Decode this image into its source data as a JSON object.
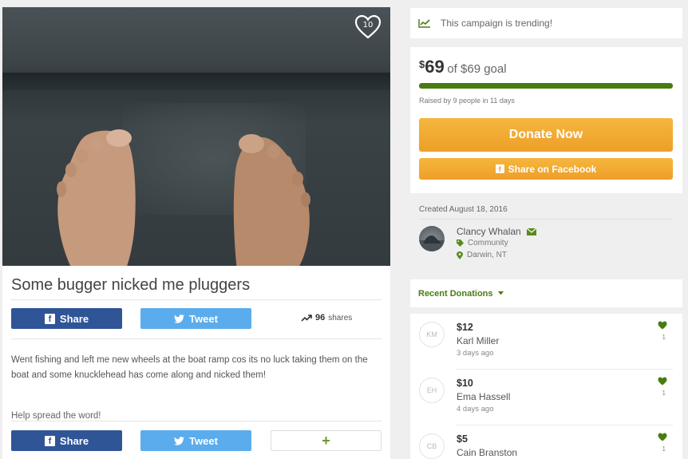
{
  "campaign": {
    "title": "Some bugger nicked me pluggers",
    "likes": "10",
    "shares_count": "96",
    "shares_label": "shares",
    "description": "Went fishing and left me new wheels at the boat ramp cos its no luck taking them on the boat and some knucklehead has come along and nicked them!",
    "spread": "Help spread the word!"
  },
  "social": {
    "share_label": "Share",
    "tweet_label": "Tweet",
    "plus_label": "+"
  },
  "trending": {
    "text": "This campaign is trending!"
  },
  "goal": {
    "currency": "$",
    "raised": "69",
    "of_goal": "of $69 goal",
    "progress_percent": 100,
    "raised_by": "Raised by 9 people in 11 days",
    "donate_label": "Donate Now",
    "share_fb_label": "Share on Facebook"
  },
  "organizer": {
    "created": "Created August 18, 2016",
    "name": "Clancy Whalan",
    "category": "Community",
    "location": "Darwin, NT"
  },
  "recent": {
    "label": "Recent Donations",
    "items": [
      {
        "initials": "KM",
        "amount": "$12",
        "name": "Karl Miller",
        "ago": "3 days ago",
        "hearts": "1"
      },
      {
        "initials": "EH",
        "amount": "$10",
        "name": "Ema Hassell",
        "ago": "4 days ago",
        "hearts": "1"
      },
      {
        "initials": "CB",
        "amount": "$5",
        "name": "Cain Branston",
        "ago": "",
        "hearts": "1"
      }
    ]
  },
  "colors": {
    "facebook": "#2f5597",
    "twitter": "#5aacec",
    "donate": "#f0a32e",
    "accent_green": "#4a7a12"
  }
}
